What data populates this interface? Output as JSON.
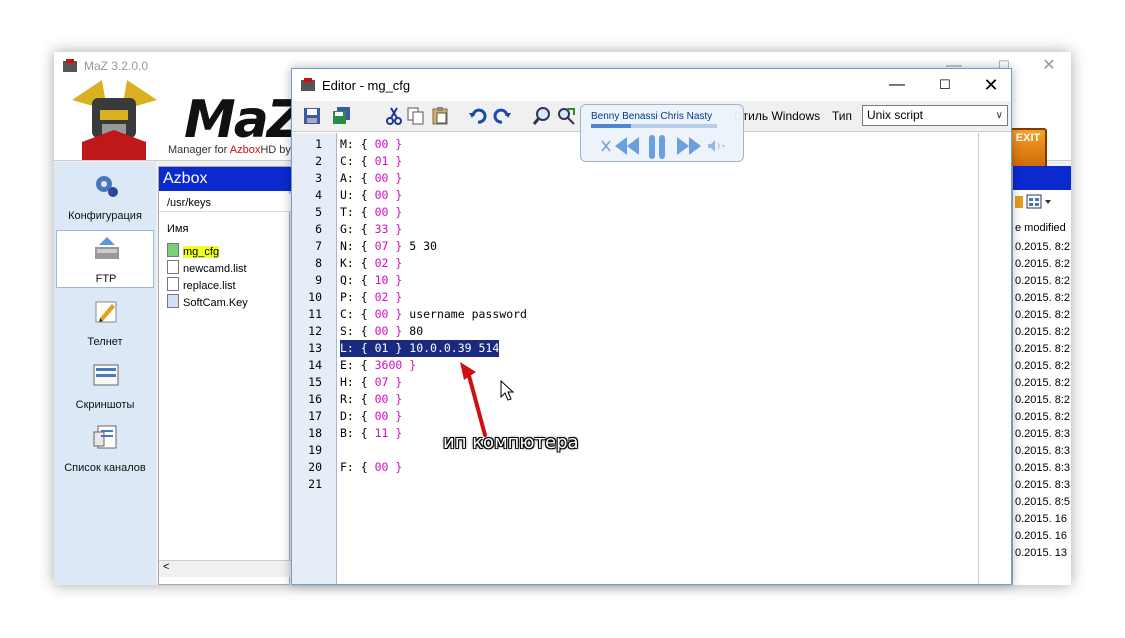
{
  "main_window": {
    "title": "MaZ 3.2.0.0",
    "min_glyph": "—",
    "max_glyph": "☐",
    "close_glyph": "✕",
    "logo_text": "MaZ",
    "subtitle_prefix": "Manager for ",
    "subtitle_azbox": "Azbox",
    "subtitle_hd": "HD by",
    "exit_label": "EXIT"
  },
  "sidebar": {
    "items": [
      {
        "label": "Конфигурация",
        "icon": "gears-icon"
      },
      {
        "label": "FTP",
        "icon": "ftp-icon"
      },
      {
        "label": "Телнет",
        "icon": "pen-icon"
      },
      {
        "label": "Скриншоты",
        "icon": "screenshot-icon"
      },
      {
        "label": "Список каналов",
        "icon": "channels-icon"
      }
    ]
  },
  "file_panel": {
    "header": "Azbox",
    "path": "/usr/keys",
    "column_name": "Имя",
    "files": [
      "mg_cfg",
      "newcamd.list",
      "replace.list",
      "SoftCam.Key"
    ],
    "scroll_left": "<"
  },
  "right_panel": {
    "column_modified": "e modified",
    "dates": [
      "0.2015. 8:2",
      "0.2015. 8:2",
      "0.2015. 8:2",
      "0.2015. 8:2",
      "0.2015. 8:2",
      "0.2015. 8:2",
      "0.2015. 8:2",
      "0.2015. 8:2",
      "0.2015. 8:2",
      "0.2015. 8:2",
      "0.2015. 8:2",
      "0.2015. 8:3",
      "0.2015. 8:3",
      "0.2015. 8:3",
      "0.2015. 8:3",
      "0.2015. 8:5",
      "0.2015. 16",
      "0.2015. 16",
      "0.2015. 13"
    ]
  },
  "editor": {
    "title": "Editor - mg_cfg",
    "min_glyph": "—",
    "max_glyph": "☐",
    "close_glyph": "✕",
    "style_label": "Стиль Windows",
    "type_label": "Тип",
    "type_value": "Unix script",
    "selected_line": 13,
    "lines": [
      {
        "n": "1",
        "k": "M: { ",
        "v": "00",
        "t": " }",
        "x": ""
      },
      {
        "n": "2",
        "k": "C: { ",
        "v": "01",
        "t": " }",
        "x": ""
      },
      {
        "n": "3",
        "k": "A: { ",
        "v": "00",
        "t": " }",
        "x": ""
      },
      {
        "n": "4",
        "k": "U: { ",
        "v": "00",
        "t": " }",
        "x": ""
      },
      {
        "n": "5",
        "k": "T: { ",
        "v": "00",
        "t": " }",
        "x": ""
      },
      {
        "n": "6",
        "k": "G: { ",
        "v": "33",
        "t": " }",
        "x": ""
      },
      {
        "n": "7",
        "k": "N: { ",
        "v": "07",
        "t": " }",
        "x": " 5 30"
      },
      {
        "n": "8",
        "k": "K: { ",
        "v": "02",
        "t": " }",
        "x": ""
      },
      {
        "n": "9",
        "k": "Q: { ",
        "v": "10",
        "t": " }",
        "x": ""
      },
      {
        "n": "10",
        "k": "P: { ",
        "v": "02",
        "t": " }",
        "x": ""
      },
      {
        "n": "11",
        "k": "C: { ",
        "v": "00",
        "t": " }",
        "x": " username password"
      },
      {
        "n": "12",
        "k": "S: { ",
        "v": "00",
        "t": " }",
        "x": " 80"
      },
      {
        "n": "13",
        "k": "L: { ",
        "v": "01",
        "t": " }",
        "x": " 10.0.0.39 514"
      },
      {
        "n": "14",
        "k": "E: { ",
        "v": "3600",
        "t": " }",
        "x": ""
      },
      {
        "n": "15",
        "k": "H: { ",
        "v": "07",
        "t": " }",
        "x": ""
      },
      {
        "n": "16",
        "k": "R: { ",
        "v": "00",
        "t": " }",
        "x": ""
      },
      {
        "n": "17",
        "k": "D: { ",
        "v": "00",
        "t": " }",
        "x": ""
      },
      {
        "n": "18",
        "k": "B: { ",
        "v": "11",
        "t": " }",
        "x": ""
      },
      {
        "n": "19",
        "k": "",
        "v": "",
        "t": "",
        "x": ""
      },
      {
        "n": "20",
        "k": "F: { ",
        "v": "00",
        "t": " }",
        "x": ""
      },
      {
        "n": "21",
        "k": "",
        "v": "",
        "t": "",
        "x": ""
      }
    ]
  },
  "media_player": {
    "track": "Benny Benassi  Chris Nasty",
    "progress": 0.32
  },
  "annotation": {
    "text": "ип компютера"
  },
  "colors": {
    "selection": "#1a2a80",
    "value": "#d010c0",
    "azbox_header": "#0a2ad0",
    "highlight": "#f0ff26",
    "arrow": "#d01010"
  }
}
